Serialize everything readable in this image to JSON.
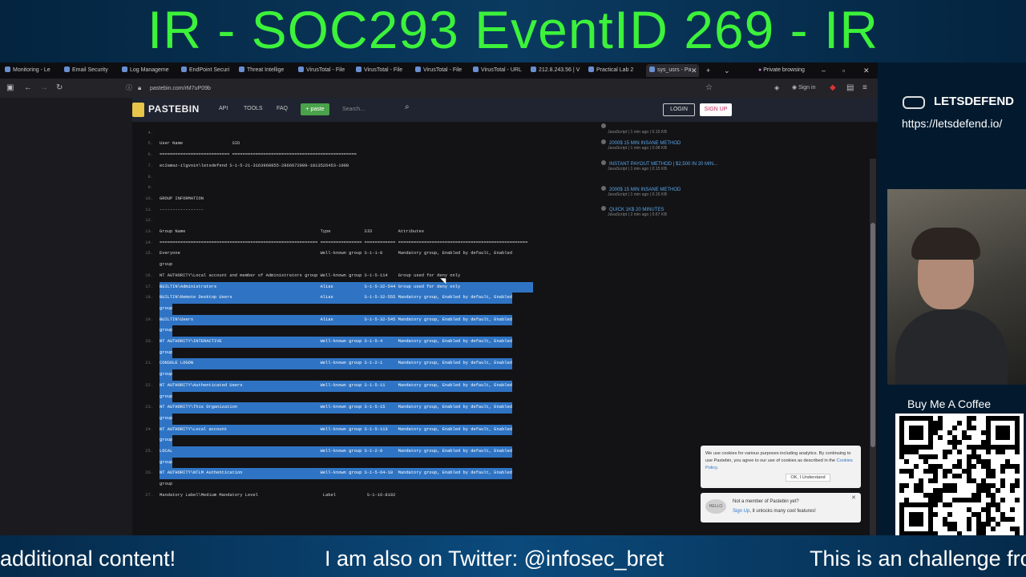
{
  "banner": {
    "title": "IR - SOC293 EventID 269 - IR"
  },
  "browser": {
    "tabs": [
      "Monitoring - Le",
      "Email Security",
      "Log Manageme",
      "EndPoint Securi",
      "Threat Intellige",
      "VirusTotal - File",
      "VirusTotal - File",
      "VirusTotal - File",
      "VirusTotal - URL",
      "212.8.243.56 | V",
      "Practical Lab 2",
      "sys_usrs - Pa"
    ],
    "private_label": "Private browsing",
    "url": "pastebin.com/rM7uP09b",
    "signin": "Sign in"
  },
  "pastebin": {
    "name": "PASTEBIN",
    "nav": [
      "API",
      "TOOLS",
      "FAQ"
    ],
    "paste_label": "paste",
    "search_placeholder": "Search...",
    "login": "LOGIN",
    "signup": "SIGN UP",
    "lines": [
      {
        "n": "",
        "t": "----------------",
        "hl": false
      },
      {
        "n": "4.",
        "t": "",
        "hl": false
      },
      {
        "n": "5.",
        "t": "User Name                   SID",
        "hl": false
      },
      {
        "n": "6.",
        "t": "=========================== ================================================",
        "hl": false
      },
      {
        "n": "7.",
        "t": "ec2amaz-ilgvoin\\letsdefend S-1-5-21-3163960855-2866672989-1813526453-1008",
        "hl": false
      },
      {
        "n": "8.",
        "t": "",
        "hl": false
      },
      {
        "n": "9.",
        "t": "",
        "hl": false
      },
      {
        "n": "10.",
        "t": "GROUP INFORMATION",
        "hl": false
      },
      {
        "n": "11.",
        "t": "-----------------",
        "hl": false
      },
      {
        "n": "12.",
        "t": "",
        "hl": false
      },
      {
        "n": "13.",
        "t": "Group Name                                                    Type             SID          Attributes",
        "hl": false
      },
      {
        "n": "14.",
        "t": "============================================================= ================ ============ ==================================================",
        "hl": false
      },
      {
        "n": "15.",
        "t": "Everyone                                                      Well-known group S-1-1-0      Mandatory group, Enabled by default, Enabled",
        "hl": false
      },
      {
        "n": "",
        "t": "group",
        "hl": false
      },
      {
        "n": "16.",
        "t": "NT AUTHORITY\\Local account and member of Administrators group Well-known group S-1-5-114    Group used for deny only",
        "hl": false
      },
      {
        "n": "17.",
        "t": "BUILTIN\\Administrators                                        Alias            S-1-5-32-544 Group used for deny only                            ",
        "hl": true
      },
      {
        "n": "18.",
        "t": "BUILTIN\\Remote Desktop Users                                  Alias            S-1-5-32-555 Mandatory group, Enabled by default, Enabled",
        "hl": true
      },
      {
        "n": "",
        "t": "group",
        "hl": true
      },
      {
        "n": "19.",
        "t": "BUILTIN\\Users                                                 Alias            S-1-5-32-545 Mandatory group, Enabled by default, Enabled",
        "hl": true
      },
      {
        "n": "",
        "t": "group",
        "hl": true
      },
      {
        "n": "20.",
        "t": "NT AUTHORITY\\INTERACTIVE                                      Well-known group S-1-5-4      Mandatory group, Enabled by default, Enabled",
        "hl": true
      },
      {
        "n": "",
        "t": "group",
        "hl": true
      },
      {
        "n": "21.",
        "t": "CONSOLE LOGON                                                 Well-known group S-1-2-1      Mandatory group, Enabled by default, Enabled",
        "hl": true
      },
      {
        "n": "",
        "t": "group",
        "hl": true
      },
      {
        "n": "22.",
        "t": "NT AUTHORITY\\Authenticated Users                              Well-known group S-1-5-11     Mandatory group, Enabled by default, Enabled",
        "hl": true
      },
      {
        "n": "",
        "t": "group",
        "hl": true
      },
      {
        "n": "23.",
        "t": "NT AUTHORITY\\This Organization                                Well-known group S-1-5-15     Mandatory group, Enabled by default, Enabled",
        "hl": true
      },
      {
        "n": "",
        "t": "group",
        "hl": true
      },
      {
        "n": "24.",
        "t": "NT AUTHORITY\\Local account                                    Well-known group S-1-5-113    Mandatory group, Enabled by default, Enabled",
        "hl": true
      },
      {
        "n": "",
        "t": "group",
        "hl": true
      },
      {
        "n": "25.",
        "t": "LOCAL                                                         Well-known group S-1-2-0      Mandatory group, Enabled by default, Enabled",
        "hl": true
      },
      {
        "n": "",
        "t": "group",
        "hl": true
      },
      {
        "n": "26.",
        "t": "NT AUTHORITY\\NTLM Authentication                              Well-known group S-1-5-64-10  Mandatory group, Enabled by default, Enabled",
        "hl": true
      },
      {
        "n": "",
        "t": "group",
        "hl": false
      },
      {
        "n": "27.",
        "t": "Mandatory Label\\Medium Mandatory Level                         Label            S-1-16-8192",
        "hl": false
      }
    ],
    "sidebar": [
      {
        "title": "",
        "meta": "JavaScript | 1 min ago | 0.15 KB"
      },
      {
        "title": "2000$ 15 MIN INSANE METHOD",
        "meta": "JavaScript | 1 min ago | 0.08 KB"
      },
      {
        "title": "INSTANT PAYOUT METHOD  | $2,500 IN 20 MIN...",
        "meta": "JavaScript | 1 min ago | 0.15 KB"
      },
      {
        "title": "2000$ 15 MIN INSANE METHOD",
        "meta": "JavaScript | 1 min ago | 0.15 KB"
      },
      {
        "title": "QUICK 1K$ 20 MINUTES",
        "meta": "JavaScript | 2 min ago | 0.67 KB"
      }
    ],
    "cookie": {
      "text": "We use cookies for various purposes including analytics. By continuing to use Pastebin, you agree to our use of cookies as described in the",
      "policy": "Cookies Policy.",
      "ok": "OK, I Understand"
    },
    "member": {
      "hello": "HELLO",
      "question": "Not a member of Pastebin yet?",
      "signup": "Sign Up",
      "rest": ", it unlocks many cool features!"
    }
  },
  "overlay": {
    "brand": "LETSDEFEND",
    "url": "https://letsdefend.io/",
    "coffee": "Buy Me A Coffee"
  },
  "ticker": [
    "additional content!",
    "I am also on Twitter: @infosec_bret",
    "This is an challenge from"
  ]
}
